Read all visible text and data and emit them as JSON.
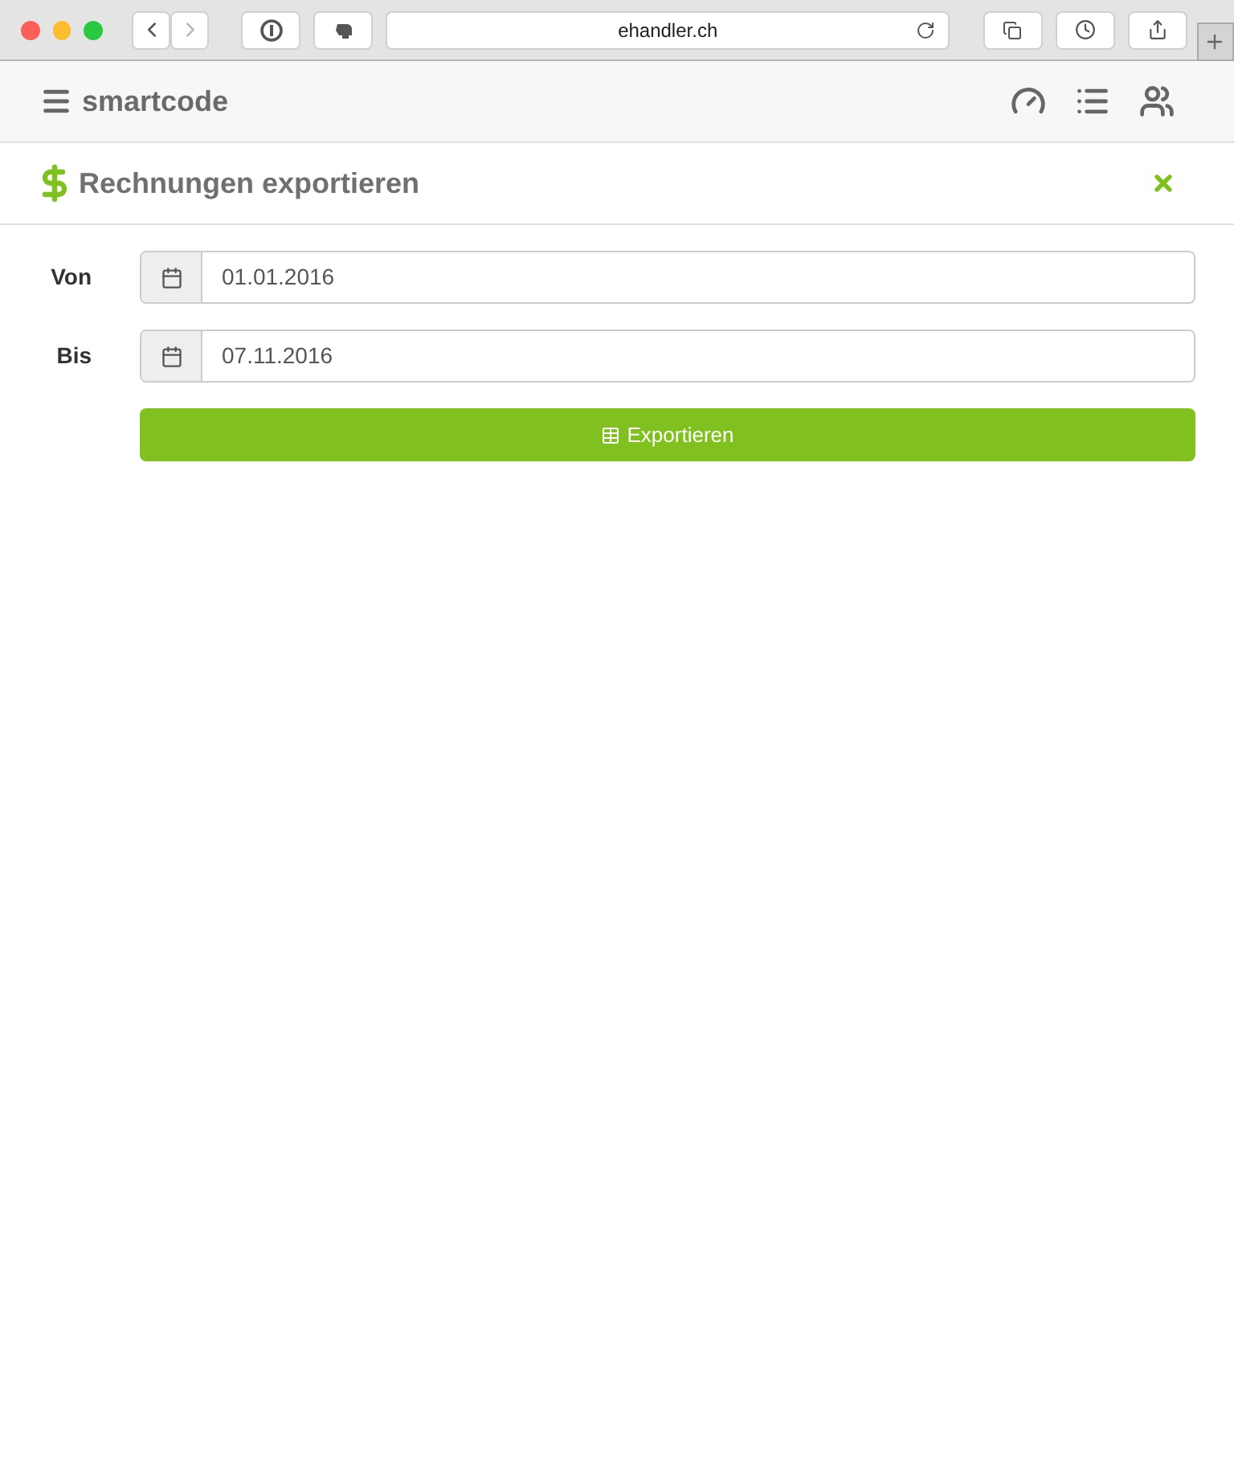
{
  "browser": {
    "url": "ehandler.ch"
  },
  "navbar": {
    "brand": "smartcode"
  },
  "page": {
    "title": "Rechnungen exportieren"
  },
  "form": {
    "fields": [
      {
        "label": "Von",
        "value": "01.01.2016"
      },
      {
        "label": "Bis",
        "value": "07.11.2016"
      }
    ],
    "button": "Exportieren"
  }
}
